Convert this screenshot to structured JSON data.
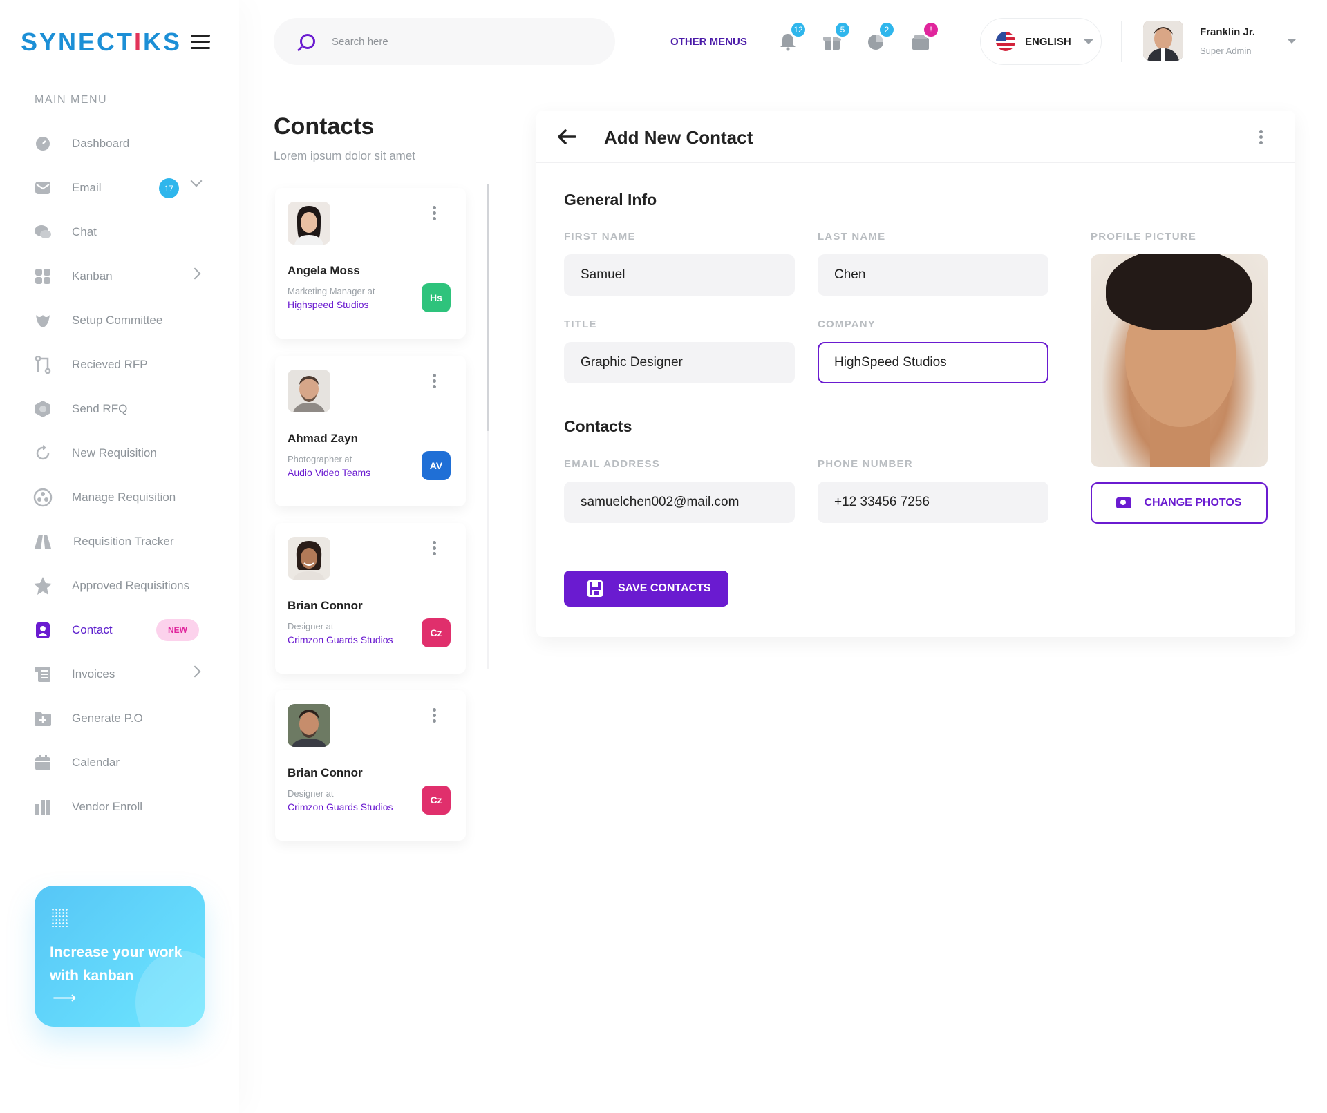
{
  "brand": {
    "logo_a": "SYNECT",
    "logo_i": "I",
    "logo_b": "KS"
  },
  "sidebar": {
    "menu_title": "MAIN MENU",
    "items": [
      {
        "label": "Dashboard",
        "icon": "dashboard-icon"
      },
      {
        "label": "Email",
        "icon": "email-icon",
        "badge": "17"
      },
      {
        "label": "Chat",
        "icon": "chat-icon"
      },
      {
        "label": "Kanban",
        "icon": "kanban-icon"
      },
      {
        "label": "Setup Committee",
        "icon": "committee-icon"
      },
      {
        "label": "Recieved RFP",
        "icon": "rfp-icon"
      },
      {
        "label": "Send RFQ",
        "icon": "rfq-icon"
      },
      {
        "label": "New Requisition",
        "icon": "refresh-icon"
      },
      {
        "label": "Manage Requisition",
        "icon": "manage-icon"
      },
      {
        "label": "Requisition Tracker",
        "icon": "tracker-icon"
      },
      {
        "label": "Approved Requisitions",
        "icon": "star-icon"
      },
      {
        "label": "Contact",
        "icon": "contact-icon",
        "badge": "NEW"
      },
      {
        "label": "Invoices",
        "icon": "invoice-icon"
      },
      {
        "label": "Generate P.O",
        "icon": "folder-plus-icon"
      },
      {
        "label": "Calendar",
        "icon": "calendar-icon"
      },
      {
        "label": "Vendor Enroll",
        "icon": "vendor-icon"
      }
    ],
    "promo": {
      "text": "Increase your work with kanban",
      "arrow": "⟶"
    }
  },
  "topbar": {
    "search_placeholder": "Search here",
    "other_menus": "OTHER MENUS",
    "notifications": [
      "12",
      "5",
      "2",
      "!"
    ],
    "language": "ENGLISH",
    "user_name": "Franklin Jr.",
    "user_role": "Super Admin"
  },
  "contacts": {
    "title": "Contacts",
    "subtitle": "Lorem ipsum  dolor sit amet",
    "cards": [
      {
        "name": "Angela Moss",
        "role": "Marketing Manager at",
        "company": "Highspeed Studios",
        "badge": "Hs",
        "badge_color": "#2ec37c"
      },
      {
        "name": "Ahmad Zayn",
        "role": "Photographer at",
        "company": "Audio Video Teams",
        "badge": "AV",
        "badge_color": "#1f6fd6"
      },
      {
        "name": "Brian Connor",
        "role": "Designer at",
        "company": "Crimzon Guards Studios",
        "badge": "Cz",
        "badge_color": "#e02f6c"
      },
      {
        "name": "Brian Connor",
        "role": "Designer at",
        "company": "Crimzon Guards Studios",
        "badge": "Cz",
        "badge_color": "#e02f6c"
      }
    ]
  },
  "form": {
    "title": "Add New Contact",
    "general_info": "General Info",
    "first_name_label": "FIRST NAME",
    "first_name": "Samuel",
    "last_name_label": "LAST NAME",
    "last_name": "Chen",
    "title_label": "TITLE",
    "title_value": "Graphic Designer",
    "company_label": "COMPANY",
    "company_value": "HighSpeed Studios",
    "contacts_section": "Contacts",
    "email_label": "EMAIL ADDRESS",
    "email_value": "samuelchen002@mail.com",
    "phone_label": "PHONE NUMBER",
    "phone_value": "+12 33456 7256",
    "profile_label": "PROFILE PICTURE",
    "change_photos": "CHANGE PHOTOS",
    "save": "SAVE CONTACTS"
  },
  "colors": {
    "accent": "#6a1bd0",
    "brand_blue": "#1c8fd6",
    "pink": "#e0259c",
    "cyan": "#2fb6ec"
  }
}
